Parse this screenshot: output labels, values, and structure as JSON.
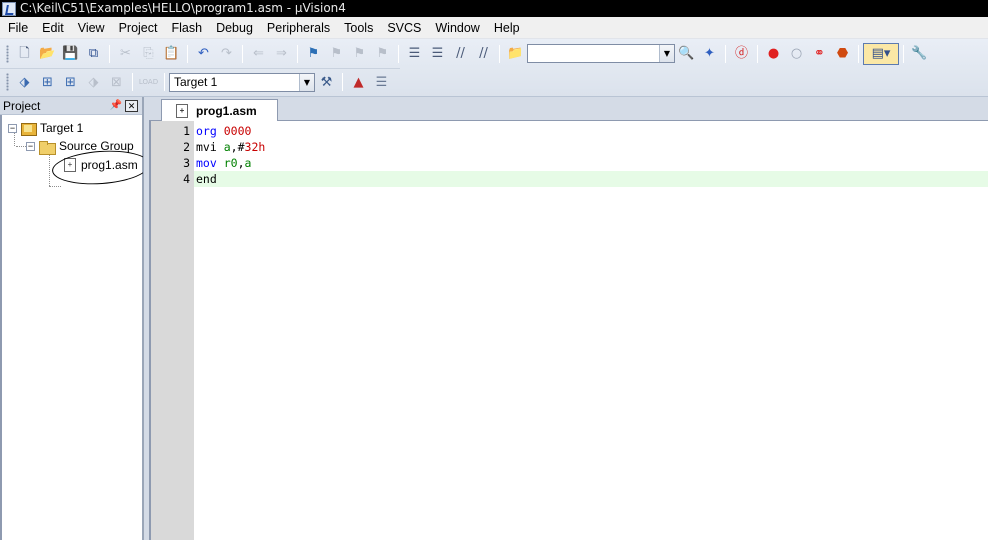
{
  "window": {
    "title": "C:\\Keil\\C51\\Examples\\HELLO\\program1.asm - µVision4"
  },
  "menu": [
    "File",
    "Edit",
    "View",
    "Project",
    "Flash",
    "Debug",
    "Peripherals",
    "Tools",
    "SVCS",
    "Window",
    "Help"
  ],
  "toolbar": {
    "find_combo_value": "",
    "target_combo_value": "Target 1"
  },
  "project_panel": {
    "title": "Project",
    "tree": {
      "target": "Target 1",
      "group": "Source Group",
      "file": "prog1.asm"
    }
  },
  "editor": {
    "tab_label": "prog1.asm",
    "lines": [
      {
        "num": "1",
        "tokens": [
          {
            "t": "org",
            "c": "kw"
          },
          {
            "t": " ",
            "c": "plain"
          },
          {
            "t": "0000",
            "c": "num"
          }
        ]
      },
      {
        "num": "2",
        "tokens": [
          {
            "t": "mvi",
            "c": "plain"
          },
          {
            "t": " ",
            "c": "plain"
          },
          {
            "t": "a",
            "c": "reg"
          },
          {
            "t": ",#",
            "c": "plain"
          },
          {
            "t": "32h",
            "c": "num"
          }
        ]
      },
      {
        "num": "3",
        "tokens": [
          {
            "t": "mov",
            "c": "kw"
          },
          {
            "t": " ",
            "c": "plain"
          },
          {
            "t": "r0",
            "c": "reg"
          },
          {
            "t": ",",
            "c": "plain"
          },
          {
            "t": "a",
            "c": "reg"
          }
        ]
      },
      {
        "num": "4",
        "tokens": [
          {
            "t": "end",
            "c": "plain"
          }
        ]
      }
    ],
    "current_line": 4
  }
}
